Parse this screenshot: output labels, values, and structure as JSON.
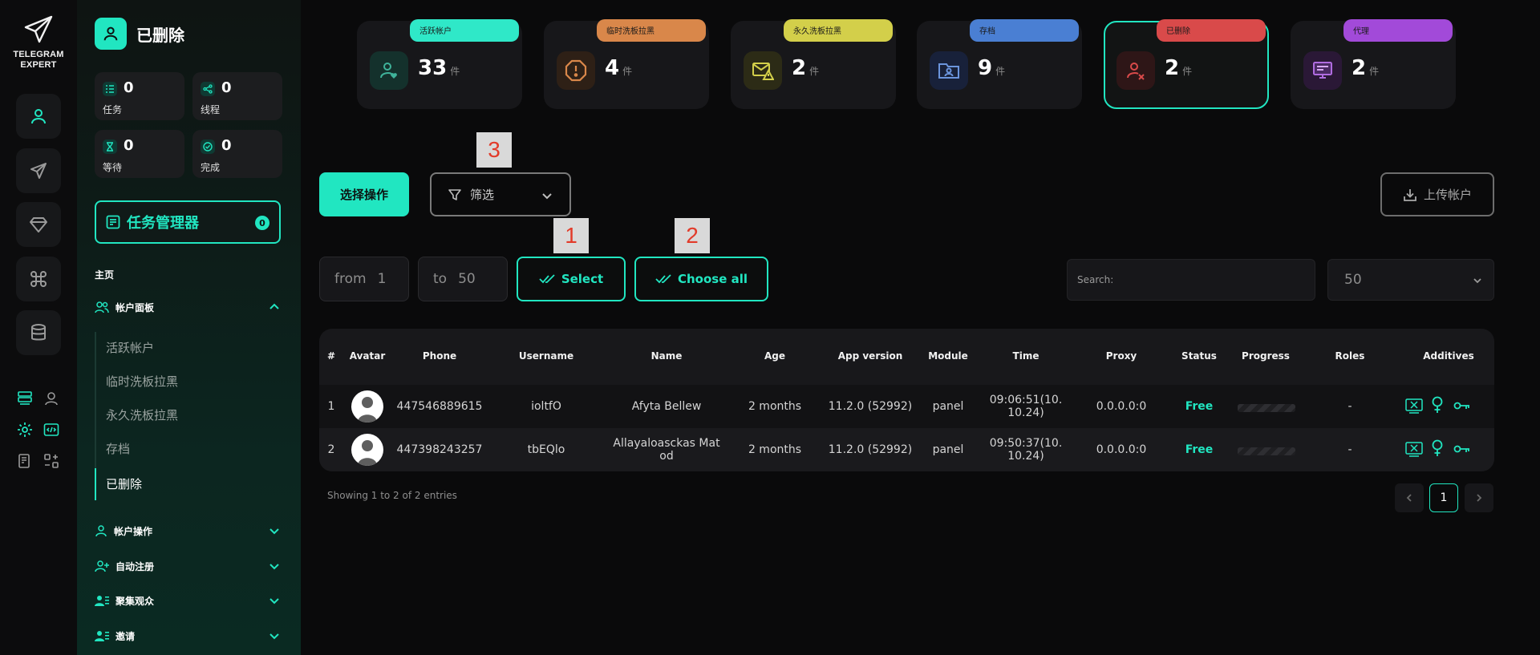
{
  "app": {
    "logo_line1": "TELEGRAM",
    "logo_line2": "EXPERT",
    "accent": "#21e6c1"
  },
  "rail": {
    "buttons": [
      {
        "icon": "user-icon",
        "active": true
      },
      {
        "icon": "send-icon"
      },
      {
        "icon": "diamond-icon"
      },
      {
        "icon": "command-icon"
      },
      {
        "icon": "database-icon"
      }
    ],
    "small_icons": [
      "server-list-icon",
      "location-pin-icon",
      "gear-icon",
      "code-window-icon",
      "document-check-icon",
      "grid-swap-icon"
    ]
  },
  "sidebar": {
    "title": "已删除",
    "stats": [
      {
        "value": "0",
        "label": "任务"
      },
      {
        "value": "0",
        "label": "线程"
      },
      {
        "value": "0",
        "label": "等待"
      },
      {
        "value": "0",
        "label": "完成"
      }
    ],
    "task_manager": {
      "label": "任务管理器",
      "count": "0"
    },
    "section_title": "主页",
    "account_panel": "帐户面板",
    "sub_items": [
      "活跃帐户",
      "临时洗板拉黑",
      "永久洗板拉黑",
      "存档",
      "已删除"
    ],
    "active_sub_index": 4,
    "groups": [
      "帐户操作",
      "自动注册",
      "聚集观众",
      "邀请"
    ]
  },
  "categories": [
    {
      "label": "活跃帐户",
      "count": "33",
      "unit": "件",
      "color": "#2fe8c8",
      "icon": "user-heart-icon"
    },
    {
      "label": "临时洗板拉黑",
      "count": "4",
      "unit": "件",
      "color": "#d9874a",
      "icon": "warning-octagon-icon"
    },
    {
      "label": "永久洗板拉黑",
      "count": "2",
      "unit": "件",
      "color": "#d3cf4a",
      "icon": "mail-warning-icon"
    },
    {
      "label": "存档",
      "count": "9",
      "unit": "件",
      "color": "#4a7fd3",
      "icon": "folder-user-icon"
    },
    {
      "label": "已删除",
      "count": "2",
      "unit": "件",
      "color": "#d94a4a",
      "icon": "user-x-icon",
      "active": true
    },
    {
      "label": "代理",
      "count": "2",
      "unit": "件",
      "color": "#a24ad9",
      "icon": "proxy-screen-icon"
    }
  ],
  "toolbar": {
    "select_action": "选择操作",
    "filter": "筛选",
    "upload": "上传帐户"
  },
  "markers": [
    "1",
    "2",
    "3"
  ],
  "range": {
    "from_label": "from",
    "from_value": "1",
    "to_label": "to",
    "to_value": "50",
    "select": "Select",
    "choose_all": "Choose all"
  },
  "search": {
    "placeholder": "Search:"
  },
  "page_size": "50",
  "table": {
    "columns": [
      "#",
      "Avatar",
      "Phone",
      "Username",
      "Name",
      "Age",
      "App version",
      "Module",
      "Time",
      "Proxy",
      "Status",
      "Progress",
      "Roles",
      "Additives"
    ],
    "rows": [
      {
        "idx": "1",
        "phone": "447546889615",
        "username": "ioltfO",
        "name": "Afyta Bellew",
        "age": "2 months",
        "app_version": "11.2.0 (52992)",
        "module": "panel",
        "time": "09:06:51(10.10.24)",
        "proxy": "0.0.0.0:0",
        "status": "Free",
        "progress": 0,
        "roles": "-"
      },
      {
        "idx": "2",
        "phone": "447398243257",
        "username": "tbEQlo",
        "name": "Allayaloasckas Matod",
        "age": "2 months",
        "app_version": "11.2.0 (52992)",
        "module": "panel",
        "time": "09:50:37(10.10.24)",
        "proxy": "0.0.0.0:0",
        "status": "Free",
        "progress": 0,
        "roles": "-"
      }
    ]
  },
  "footer": {
    "showing": "Showing 1 to 2 of 2 entries",
    "current_page": "1"
  }
}
